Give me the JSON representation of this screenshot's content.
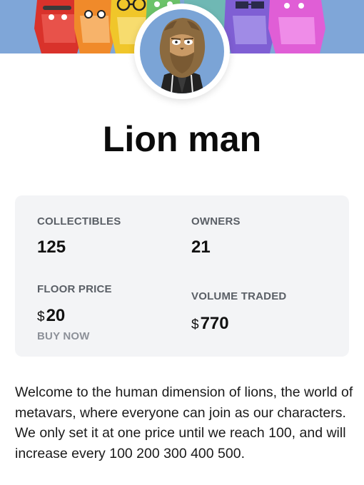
{
  "collection": {
    "name": "Lion man",
    "description": "Welcome to the human dimension of lions, the world of metavars, where everyone can join as our characters. We only set it at one price until we reach 100, and will increase every 100 200 300 400 500."
  },
  "stats": {
    "collectibles": {
      "label": "COLLECTIBLES",
      "value": "125"
    },
    "owners": {
      "label": "OWNERS",
      "value": "21"
    },
    "floor_price": {
      "label": "FLOOR PRICE",
      "currency": "$",
      "value": "20",
      "action": "BUY NOW"
    },
    "volume_traded": {
      "label": "VOLUME TRADED",
      "currency": "$",
      "value": "770"
    }
  },
  "icons": {
    "banner": "lion-characters-banner",
    "avatar": "lion-man-avatar-icon"
  },
  "colors": {
    "banner_bg": "#7fa6d8",
    "avatar_bg": "#7ba4d6",
    "stats_bg": "#f3f4f6",
    "label": "#5a5f66",
    "buy_now": "#8d9199"
  }
}
